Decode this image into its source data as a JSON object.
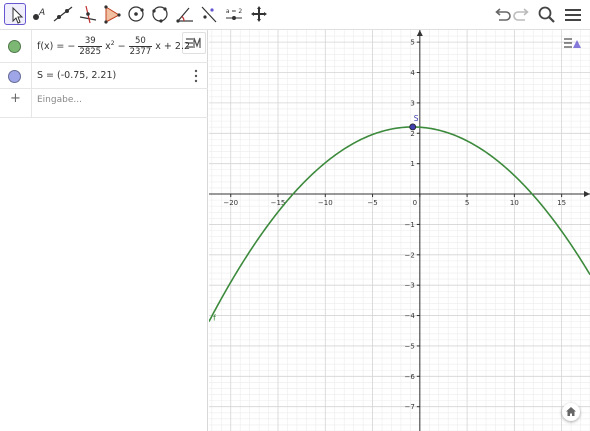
{
  "toolbar": {
    "left_tools": [
      {
        "icon": "move-arrow-icon",
        "active": true
      },
      {
        "icon": "point-icon",
        "active": false
      },
      {
        "icon": "line-icon",
        "active": false
      },
      {
        "icon": "perpendicular-line-icon",
        "active": false
      },
      {
        "icon": "polygon-icon",
        "active": false
      },
      {
        "icon": "circle-center-point-icon",
        "active": false
      },
      {
        "icon": "circle-three-points-icon",
        "active": false
      },
      {
        "icon": "angle-icon",
        "active": false
      },
      {
        "icon": "reflect-about-line-icon",
        "active": false
      },
      {
        "icon": "slider-icon",
        "active": false
      },
      {
        "icon": "move-graphics-view-icon",
        "active": false
      }
    ],
    "slider_label": "a = 2",
    "right_tools": [
      "undo-icon",
      "redo-icon",
      "search-icon",
      "hamburger-menu-icon"
    ]
  },
  "algebra": {
    "rows": [
      {
        "color": "#7cb873",
        "label": "f(x)",
        "equals": "=",
        "minus1": "−",
        "frac1_num": "39",
        "frac1_den": "2825",
        "x2": "x",
        "exp": "2",
        "minus2": "−",
        "frac2_num": "50",
        "frac2_den": "2377",
        "xterm": "x",
        "plus": "+",
        "constant": "2.2"
      },
      {
        "color": "#9ea6e8",
        "text": "S = (-0.75, 2.21)"
      }
    ],
    "input_placeholder": "Eingabe..."
  },
  "graphics": {
    "curve_color": "#3c8a3c",
    "point_label": "S",
    "curve_label": "f",
    "point_color": "#4040b0"
  },
  "chart_data": {
    "type": "line",
    "series": [
      {
        "name": "f",
        "function": "-(39/2825)x^2 - (50/2377)x + 2.2",
        "x_range": [
          -22.3,
          18
        ]
      }
    ],
    "points": [
      {
        "name": "S",
        "x": -0.75,
        "y": 2.21
      }
    ],
    "xlim": [
      -22.3,
      18
    ],
    "ylim": [
      -7.8,
      5.4
    ],
    "x_ticks": [
      -20,
      -15,
      -10,
      -5,
      0,
      5,
      10,
      15
    ],
    "y_ticks": [
      -7,
      -6,
      -5,
      -4,
      -3,
      -2,
      -1,
      1,
      2,
      3,
      4,
      5
    ],
    "grid": true
  }
}
